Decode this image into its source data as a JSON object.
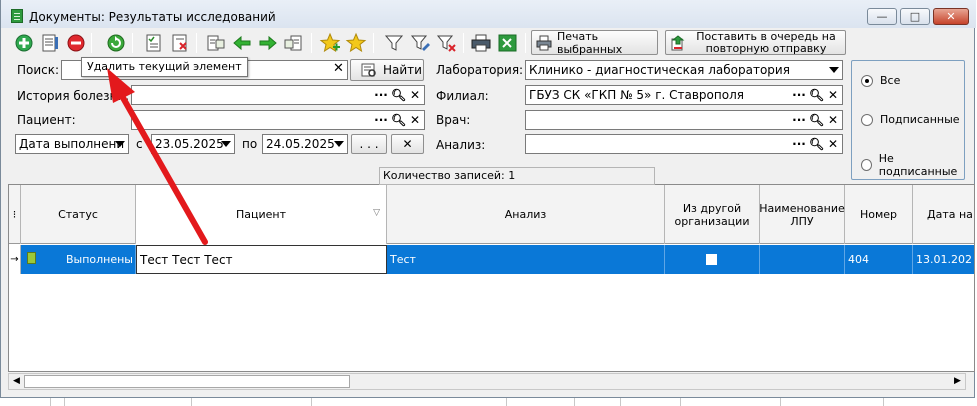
{
  "window": {
    "title": "Документы: Результаты исследований",
    "controls": {
      "minimize": "—",
      "maximize": "□",
      "close": "✕"
    }
  },
  "toolbar": {
    "icons": [
      "add-icon",
      "document-edit-icon",
      "delete-icon",
      "refresh-icon",
      "checklist-icon",
      "checklist-remove-icon",
      "export-icon",
      "arrow-left-icon",
      "arrow-right-icon",
      "import-icon",
      "star-add-icon",
      "star-icon",
      "filter-icon",
      "filter-edit-icon",
      "filter-clear-icon",
      "print-icon",
      "excel-icon"
    ],
    "print_selected": "Печать выбранных",
    "queue_resend": "Поставить в очередь на повторную отправку"
  },
  "tooltip": "Удалить текущий элемент",
  "filters": {
    "search_label": "Поиск:",
    "search_value": "",
    "find_button": "Найти",
    "history_label": "История болезни:",
    "history_value": "",
    "patient_label": "Пациент:",
    "patient_value": "",
    "date_type": "Дата выполнени",
    "from_label": "с",
    "date_from": "23.05.2025",
    "to_label": "по",
    "date_to": "24.05.2025",
    "period_button": ". . .",
    "lab_label": "Лаборатория:",
    "lab_value": "Клинико - диагностическая лаборатория",
    "branch_label": "Филиал:",
    "branch_value": "ГБУЗ СК «ГКП № 5» г. Ставрополя",
    "doctor_label": "Врач:",
    "doctor_value": "",
    "analysis_label": "Анализ:",
    "analysis_value": ""
  },
  "radio": {
    "options": [
      {
        "label": "Все",
        "selected": true
      },
      {
        "label": "Подписанные",
        "selected": false
      },
      {
        "label": "Не подписанные",
        "selected": false
      }
    ]
  },
  "grid": {
    "columns": [
      "Статус",
      "Пациент",
      "Анализ",
      "Из другой организации",
      "Наименование ЛПУ",
      "Номер",
      "Дата на"
    ],
    "rows": [
      {
        "status": "Выполнены",
        "patient": "Тест Тест Тест",
        "analysis": "Тест",
        "external": false,
        "lpu": "",
        "number": "404",
        "date": "13.01.202"
      }
    ],
    "footer": "Количество записей: 1"
  },
  "colors": {
    "selection": "#0a78d7",
    "arrow": "#e3191c",
    "title_bar": "#dbe4f0"
  }
}
